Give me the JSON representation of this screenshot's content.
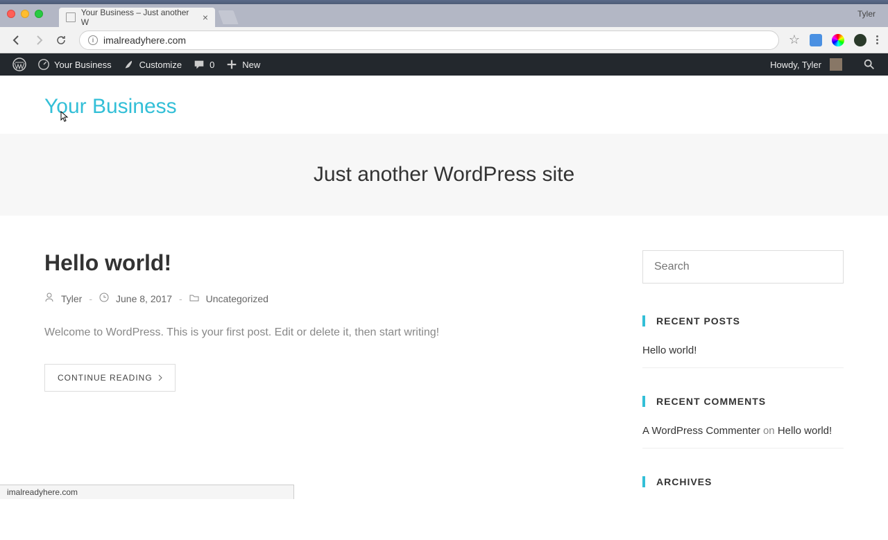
{
  "os": {
    "user_name": "Tyler"
  },
  "browser": {
    "tab_title": "Your Business – Just another W",
    "url": "imalreadyhere.com",
    "status_url": "imalreadyhere.com"
  },
  "wp_adminbar": {
    "site_name": "Your Business",
    "customize": "Customize",
    "comment_count": "0",
    "new": "New",
    "howdy": "Howdy, Tyler"
  },
  "site": {
    "title": "Your Business",
    "tagline": "Just another WordPress site"
  },
  "post": {
    "title": "Hello world!",
    "author": "Tyler",
    "date": "June 8, 2017",
    "category": "Uncategorized",
    "excerpt": "Welcome to WordPress. This is your first post. Edit or delete it, then start writing!",
    "continue": "CONTINUE READING"
  },
  "sidebar": {
    "search_placeholder": "Search",
    "recent_posts_title": "RECENT POSTS",
    "recent_post_1": "Hello world!",
    "recent_comments_title": "RECENT COMMENTS",
    "commenter": "A WordPress Commenter",
    "comment_on": " on ",
    "comment_post": "Hello world!",
    "archives_title": "ARCHIVES"
  }
}
